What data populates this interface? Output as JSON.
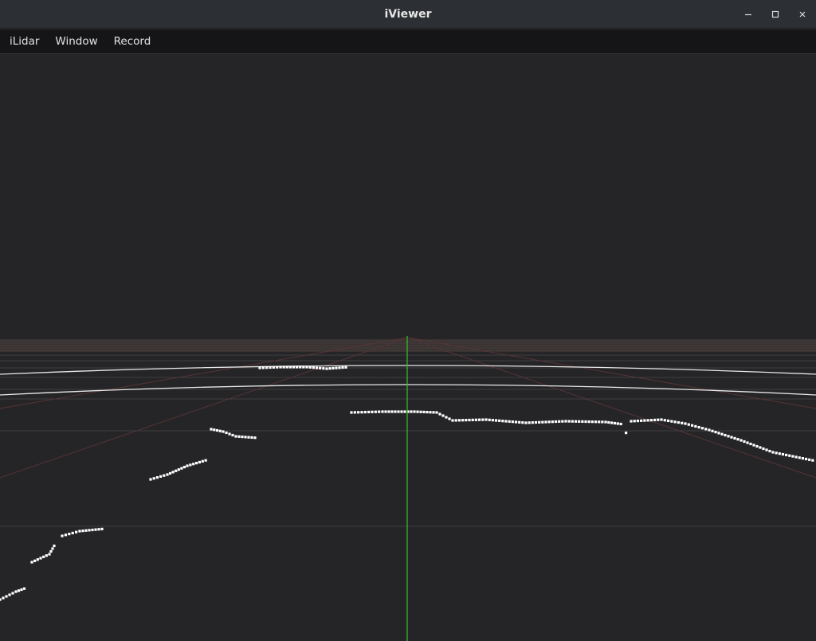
{
  "window": {
    "title": "iViewer",
    "controls": {
      "minimize": "–",
      "maximize": "□",
      "close": "×"
    }
  },
  "menubar": {
    "items": [
      {
        "label": "iLidar"
      },
      {
        "label": "Window"
      },
      {
        "label": "Record"
      }
    ]
  },
  "scene": {
    "background": "#252527",
    "ground_band_color": "#3a3231",
    "grid_color": "#4a4a4d",
    "axis_color": "#19d219",
    "point_color": "#ffffff",
    "diagonal_color": "#5a3535"
  }
}
